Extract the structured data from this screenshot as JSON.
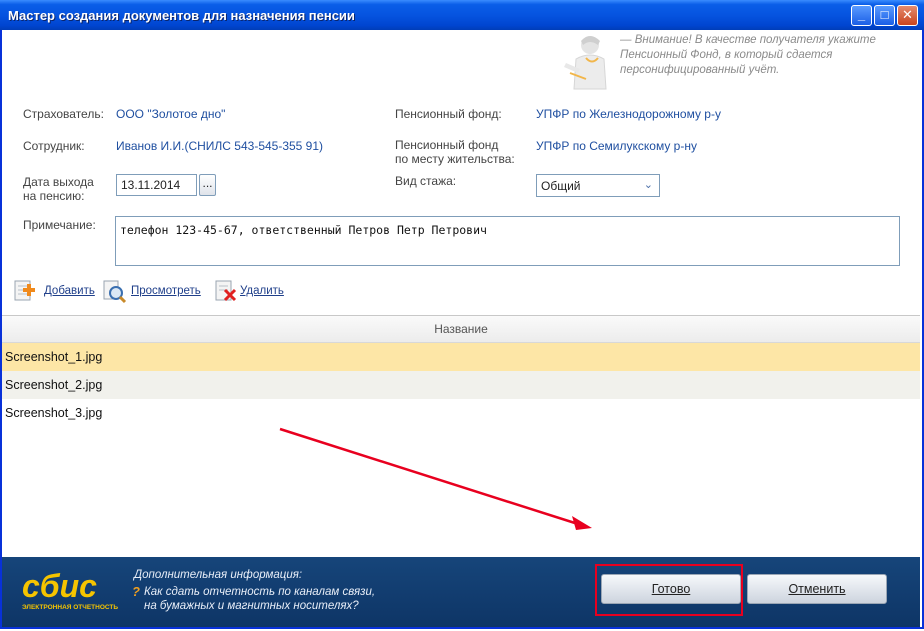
{
  "window": {
    "title": "Мастер создания документов для назначения пенсии"
  },
  "banner": {
    "text": "— Внимание! В качестве получателя укажите Пенсионный Фонд, в который сдается персонифицированный учёт."
  },
  "form": {
    "insurer_label": "Страхователь:",
    "insurer_value": "ООО \"Золотое дно\"",
    "employee_label": "Сотрудник:",
    "employee_value": "Иванов И.И.(СНИЛС 543-545-355 91)",
    "retire_date_label_1": "Дата выхода",
    "retire_date_label_2": "на пенсию:",
    "retire_date_value": "13.11.2014",
    "date_button": "...",
    "pension_fund_label": "Пенсионный фонд:",
    "pension_fund_value": "УПФР по Железнодорожному р-у",
    "pension_fund_res_label_1": "Пенсионный фонд",
    "pension_fund_res_label_2": "по месту жительства:",
    "pension_fund_res_value": "УПФР по Семилукскому р-ну",
    "service_type_label": "Вид стажа:",
    "service_type_value": "Общий",
    "note_label": "Примечание:",
    "note_value": "телефон 123-45-67, ответственный Петров Петр Петрович"
  },
  "toolbar": {
    "add": "Добавить",
    "view": "Просмотреть",
    "delete": "Удалить"
  },
  "table": {
    "header": "Название",
    "rows": [
      "Screenshot_1.jpg",
      "Screenshot_2.jpg",
      "Screenshot_3.jpg"
    ]
  },
  "footer": {
    "logo_text": "сбис",
    "logo_sub": "ЭЛЕКТРОННАЯ ОТЧЕТНОСТЬ",
    "info_title": "Дополнительная информация:",
    "info_link_1": "Как сдать отчетность по каналам связи,",
    "info_link_2": "на бумажных и магнитных носителях?",
    "done_button": "Готово",
    "cancel_button": "Отменить"
  },
  "colors": {
    "accent_red": "#e8001f",
    "title_blue": "#0654e0",
    "footer_navy": "#0e3566"
  }
}
